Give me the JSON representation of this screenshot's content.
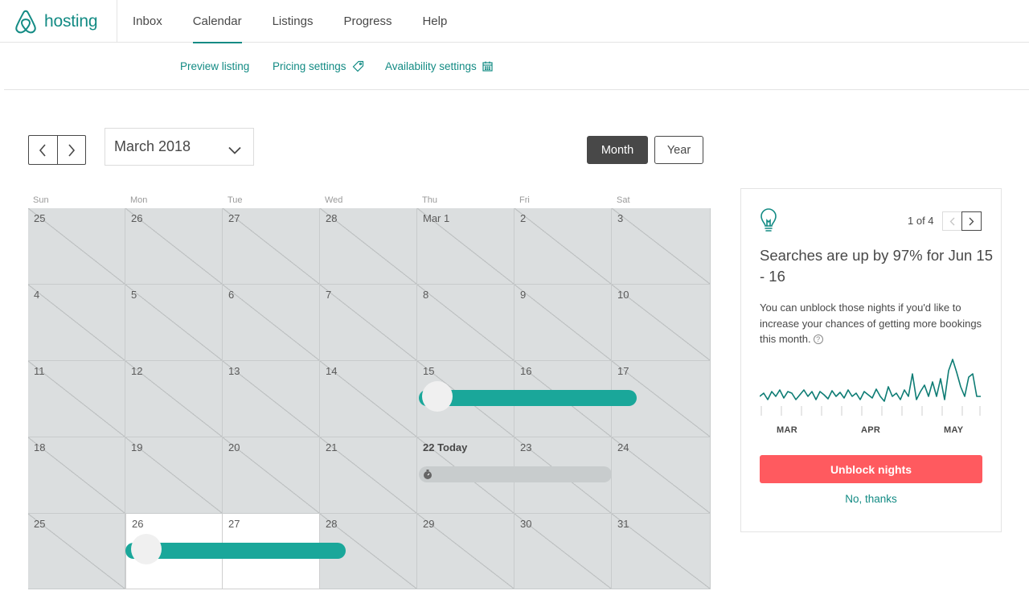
{
  "brand": {
    "name": "hosting"
  },
  "nav": {
    "tabs": [
      {
        "label": "Inbox"
      },
      {
        "label": "Calendar"
      },
      {
        "label": "Listings"
      },
      {
        "label": "Progress"
      },
      {
        "label": "Help"
      }
    ]
  },
  "subnav": {
    "preview": "Preview listing",
    "pricing": "Pricing settings",
    "availability": "Availability settings"
  },
  "calendar": {
    "month_select": "March 2018",
    "view_month": "Month",
    "view_year": "Year",
    "weekdays": [
      "Sun",
      "Mon",
      "Tue",
      "Wed",
      "Thu",
      "Fri",
      "Sat"
    ],
    "weeks": [
      [
        "25",
        "26",
        "27",
        "28",
        "Mar 1",
        "2",
        "3"
      ],
      [
        "4",
        "5",
        "6",
        "7",
        "8",
        "9",
        "10"
      ],
      [
        "11",
        "12",
        "13",
        "14",
        "15",
        "16",
        "17"
      ],
      [
        "18",
        "19",
        "20",
        "21",
        "22 Today",
        "23",
        "24"
      ],
      [
        "25",
        "26",
        "27",
        "28",
        "29",
        "30",
        "31"
      ]
    ]
  },
  "insight": {
    "counter": "1 of 4",
    "headline": "Searches are up by 97% for Jun 15 - 16",
    "body": "You can unblock those nights if you'd like to increase your chances of getting more bookings this month.",
    "help": "?",
    "months": [
      "MAR",
      "APR",
      "MAY"
    ],
    "primary": "Unblock nights",
    "secondary": "No, thanks"
  },
  "colors": {
    "brand": "#138b84",
    "bar": "#1aa79a",
    "primary_button": "#ff5a5f",
    "blocked_cell": "#dbdedf"
  }
}
